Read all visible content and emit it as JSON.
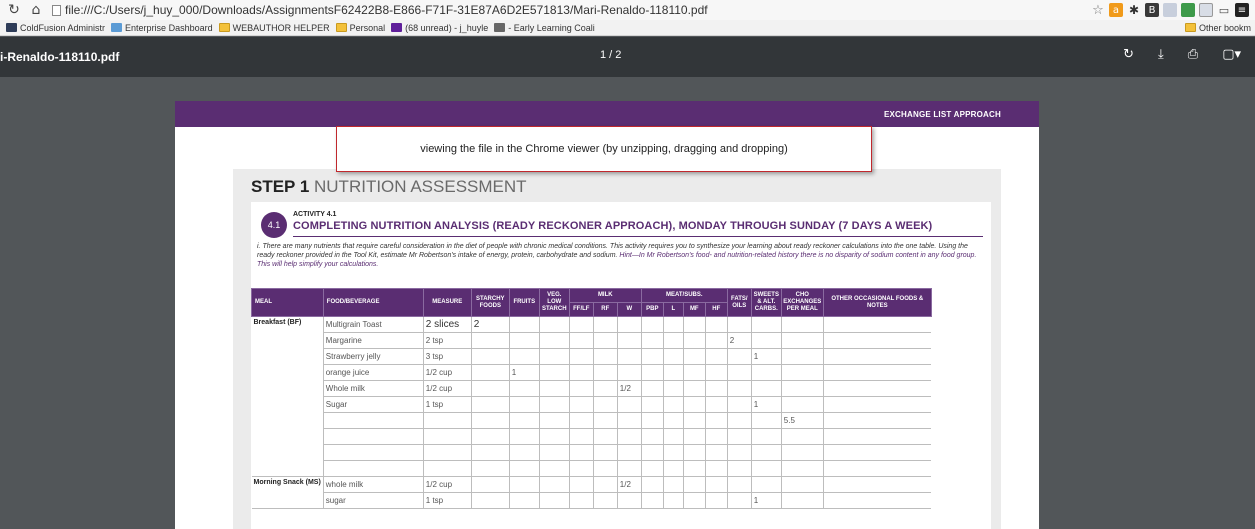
{
  "browser": {
    "url": "file:///C:/Users/j_huy_000/Downloads/AssignmentsF62422B8-E866-F71F-31E87A6D2E571813/Mari-Renaldo-118110.pdf",
    "bookmarks": [
      {
        "label": "ColdFusion Administr",
        "icon": "cf-icon"
      },
      {
        "label": "Enterprise Dashboard",
        "icon": "dashboard-icon"
      },
      {
        "label": "WEBAUTHOR HELPER",
        "icon": "folder-icon"
      },
      {
        "label": "Personal",
        "icon": "folder-icon"
      },
      {
        "label": "(68 unread) - j_huyle",
        "icon": "yahoo-icon"
      },
      {
        "label": "- Early Learning Coali",
        "icon": "page-icon"
      }
    ],
    "other_bookmarks": "Other bookm"
  },
  "pdf_viewer": {
    "file_name": "i-Renaldo-118110.pdf",
    "page_indicator": "1 / 2"
  },
  "callout": {
    "text": "viewing the file in the Chrome viewer (by unzipping, dragging and dropping)"
  },
  "document": {
    "header_label": "EXCHANGE LIST APPROACH",
    "step_bold": "STEP 1",
    "step_light": " NUTRITION ASSESSMENT",
    "activity_number": "4.1",
    "activity_label": "ACTIVITY 4.1",
    "activity_title": "COMPLETING NUTRITION ANALYSIS (READY RECKONER APPROACH), MONDAY THROUGH SUNDAY (7 DAYS A WEEK)",
    "intro_roman": "i.",
    "intro_main": " There are many nutrients that require careful consideration in the diet of people with chronic medical conditions. This activity requires you to synthesize your learning about ready reckoner calculations into the one table. Using the ready reckoner provided in the Tool Kit, estimate Mr Robertson's intake of energy, protein, carbohydrate and sodium.",
    "intro_hint": " Hint—In Mr Robertson's food- and nutrition-related history there is no disparity of sodium content in any food group. This will help simplify your calculations.",
    "headers": {
      "meal": "MEAL",
      "food": "FOOD/BEVERAGE",
      "measure": "MEASURE",
      "starchy": "STARCHY FOODS",
      "fruits": "FRUITS",
      "veg": "VEG. LOW STARCH",
      "milk": "MILK",
      "meat": "MEAT/SUBS.",
      "fats": "FATS/ OILS",
      "sweets": "SWEETS & ALT. CARBS.",
      "cho": "CHO EXCHANGES PER MEAL",
      "other": "OTHER OCCASIONAL FOODS & NOTES",
      "milk_sub": [
        "FF/LF",
        "RF",
        "W"
      ],
      "meat_sub": [
        "PBP",
        "L",
        "MF",
        "HF"
      ]
    },
    "breakfast_label": "Breakfast (BF)",
    "morning_label": "Morning Snack (MS)",
    "breakfast_rows": [
      {
        "food": "Multigrain Toast",
        "measure": "2 slices",
        "starchy": "2",
        "fruits": "",
        "milk_w": "",
        "fats": "",
        "sweets": "",
        "cho": ""
      },
      {
        "food": "Margarine",
        "measure": "2 tsp",
        "starchy": "",
        "fruits": "",
        "milk_w": "",
        "fats": "2",
        "sweets": "",
        "cho": ""
      },
      {
        "food": "Strawberry jelly",
        "measure": "3 tsp",
        "starchy": "",
        "fruits": "",
        "milk_w": "",
        "fats": "",
        "sweets": "1",
        "cho": ""
      },
      {
        "food": "orange juice",
        "measure": "1/2 cup",
        "starchy": "",
        "fruits": "1",
        "milk_w": "",
        "fats": "",
        "sweets": "",
        "cho": ""
      },
      {
        "food": "Whole milk",
        "measure": "1/2 cup",
        "starchy": "",
        "fruits": "",
        "milk_w": "1/2",
        "fats": "",
        "sweets": "",
        "cho": ""
      },
      {
        "food": "Sugar",
        "measure": "1 tsp",
        "starchy": "",
        "fruits": "",
        "milk_w": "",
        "fats": "",
        "sweets": "1",
        "cho": ""
      },
      {
        "food": "",
        "measure": "",
        "starchy": "",
        "fruits": "",
        "milk_w": "",
        "fats": "",
        "sweets": "",
        "cho": "5.5"
      },
      {
        "food": "",
        "measure": "",
        "starchy": "",
        "fruits": "",
        "milk_w": "",
        "fats": "",
        "sweets": "",
        "cho": ""
      },
      {
        "food": "",
        "measure": "",
        "starchy": "",
        "fruits": "",
        "milk_w": "",
        "fats": "",
        "sweets": "",
        "cho": ""
      },
      {
        "food": "",
        "measure": "",
        "starchy": "",
        "fruits": "",
        "milk_w": "",
        "fats": "",
        "sweets": "",
        "cho": ""
      }
    ],
    "morning_rows": [
      {
        "food": "whole milk",
        "measure": "1/2 cup",
        "starchy": "",
        "fruits": "",
        "milk_w": "1/2",
        "fats": "",
        "sweets": "",
        "cho": ""
      },
      {
        "food": "sugar",
        "measure": "1 tsp",
        "starchy": "",
        "fruits": "",
        "milk_w": "",
        "fats": "",
        "sweets": "1",
        "cho": ""
      }
    ]
  },
  "colors": {
    "accent_purple": "#5a2d72",
    "viewer_bg": "#525659",
    "toolbar_bg": "#323639",
    "callout_border": "#c0282d"
  }
}
